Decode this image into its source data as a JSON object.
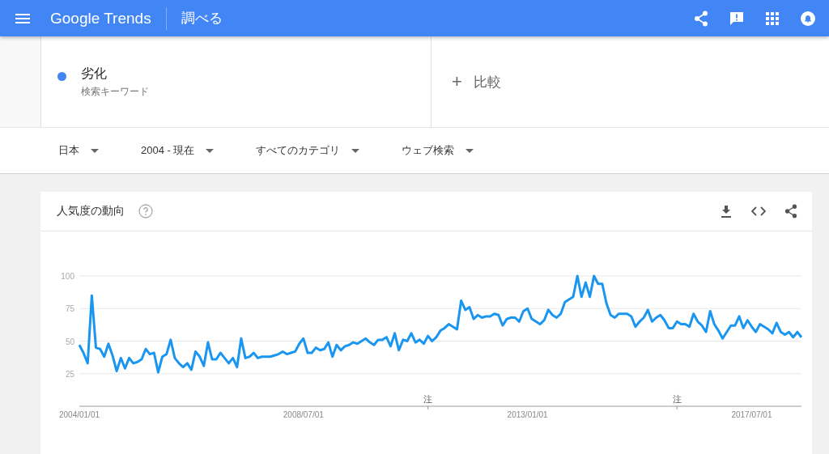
{
  "header": {
    "logo": "Google Trends",
    "section": "調べる"
  },
  "search_terms": [
    {
      "term": "劣化",
      "subtitle": "検索キーワード",
      "color": "#4285f4"
    }
  ],
  "compare": {
    "plus": "+",
    "label": "比較"
  },
  "filters": [
    {
      "label": "日本"
    },
    {
      "label": "2004 - 現在"
    },
    {
      "label": "すべてのカテゴリ"
    },
    {
      "label": "ウェブ検索"
    }
  ],
  "card": {
    "title": "人気度の動向",
    "x_axis_labels": [
      "2004/01/01",
      "2008/07/01",
      "2013/01/01",
      "2017/07/01"
    ],
    "note_markers": [
      {
        "text": "注"
      },
      {
        "text": "注"
      }
    ],
    "chart_data": {
      "type": "line",
      "ylim": [
        0,
        100
      ],
      "yticks": [
        25,
        50,
        75,
        100
      ],
      "grid": true,
      "series": [
        {
          "color": "#1a96f0",
          "values": [
            47,
            41,
            33,
            85,
            45,
            44,
            38,
            48,
            39,
            27,
            37,
            29,
            37,
            33,
            34,
            36,
            44,
            40,
            41,
            26,
            38,
            40,
            51,
            37,
            33,
            30,
            33,
            28,
            42,
            38,
            31,
            49,
            36,
            36,
            41,
            37,
            33,
            37,
            30,
            52,
            37,
            38,
            41,
            37,
            38,
            38,
            38,
            39,
            40,
            42,
            40,
            41,
            42,
            48,
            52,
            41,
            41,
            45,
            43,
            44,
            49,
            38,
            47,
            43,
            46,
            47,
            49,
            48,
            50,
            52,
            49,
            47,
            51,
            51,
            53,
            46,
            56,
            43,
            51,
            50,
            56,
            49,
            51,
            48,
            54,
            50,
            53,
            58,
            60,
            63,
            61,
            59,
            81,
            74,
            76,
            67,
            70,
            68,
            69,
            69,
            71,
            70,
            62,
            67,
            68,
            68,
            65,
            73,
            75,
            67,
            65,
            63,
            66,
            74,
            70,
            68,
            71,
            80,
            82,
            84,
            100,
            84,
            95,
            84,
            100,
            94,
            94,
            79,
            70,
            68,
            71,
            71,
            71,
            69,
            61,
            65,
            68,
            74,
            65,
            68,
            70,
            66,
            60,
            60,
            65,
            63,
            63,
            61,
            71,
            65,
            62,
            57,
            73,
            63,
            58,
            52,
            57,
            62,
            62,
            69,
            60,
            66,
            61,
            57,
            63,
            61,
            59,
            56,
            64,
            57,
            55,
            57,
            53,
            57,
            53
          ]
        }
      ]
    }
  }
}
